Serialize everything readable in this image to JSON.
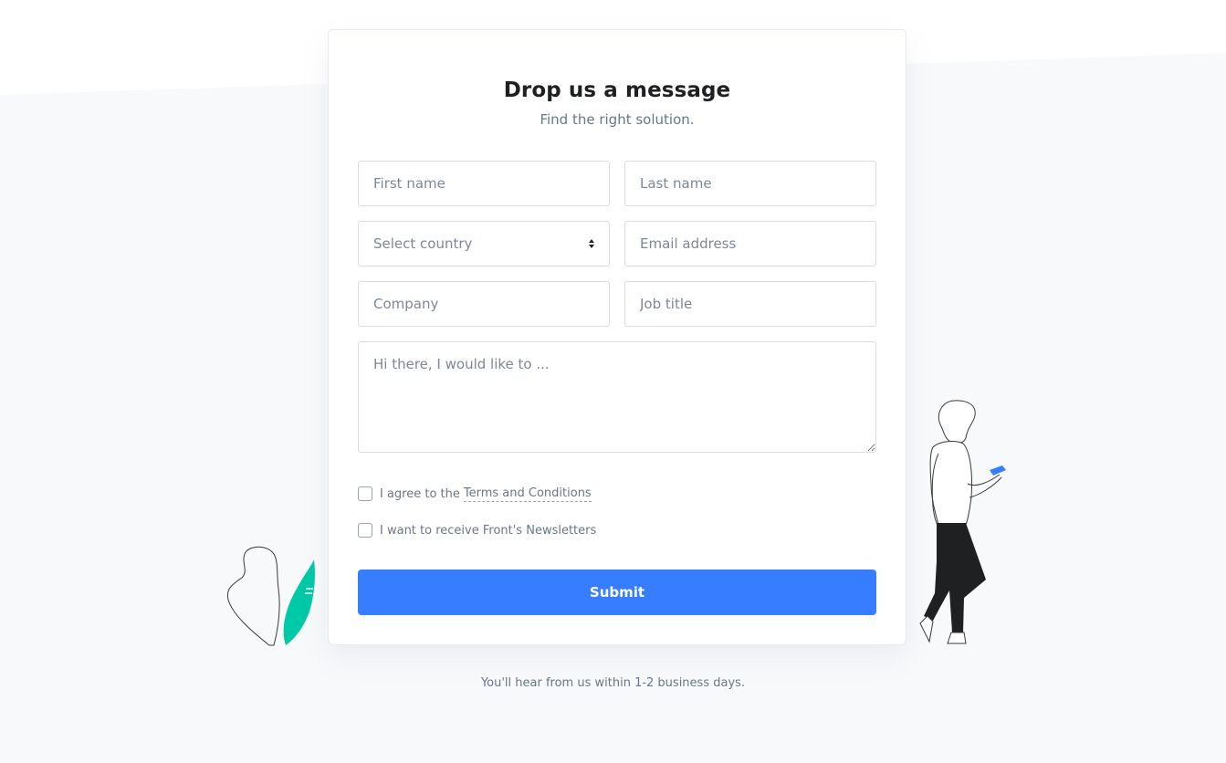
{
  "form": {
    "title": "Drop us a message",
    "subtitle": "Find the right solution.",
    "first_name_placeholder": "First name",
    "last_name_placeholder": "Last name",
    "country_selected": "Select country",
    "email_placeholder": "Email address",
    "company_placeholder": "Company",
    "job_title_placeholder": "Job title",
    "message_placeholder": "Hi there, I would like to ...",
    "agree_text": "I agree to the",
    "terms_link": "Terms and Conditions",
    "newsletter_text": "I want to receive Front's Newsletters",
    "submit_label": "Submit"
  },
  "footnote": "You'll hear from us within 1-2 business days.",
  "colors": {
    "accent": "#377dff",
    "plant": "#00c9a7",
    "background": "#f8f9fb"
  },
  "icons": {
    "select": "select-arrows-icon",
    "plant": "plant-illustration",
    "person": "person-with-phone-illustration"
  }
}
